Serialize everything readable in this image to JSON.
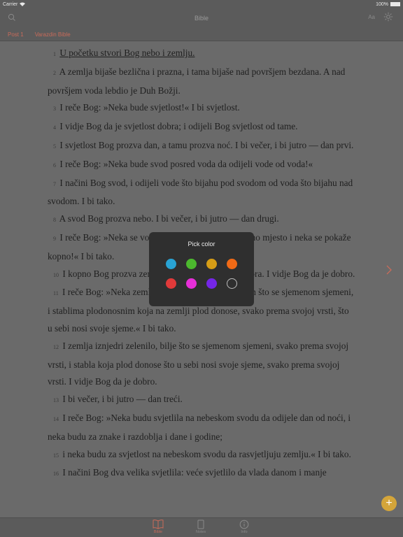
{
  "status_bar": {
    "carrier": "Carrier",
    "battery": "100%"
  },
  "nav": {
    "title": "Bible",
    "font_button": "Aa",
    "search_icon": "search-icon",
    "brightness_icon": "sun-icon"
  },
  "tabs": [
    "Post 1",
    "Varazdin Bible"
  ],
  "verses": [
    {
      "num": "1",
      "text": "U početku stvori Bog nebo i zemlju."
    },
    {
      "num": "2",
      "text": "A zemlja bijaše bezlična i prazna, i tama bijaše nad površjem bezdana. A nad površjem voda lebdio je Duh Božji."
    },
    {
      "num": "3",
      "text": "I reče Bog: »Neka bude svjetlost!« I bi svjetlost."
    },
    {
      "num": "4",
      "text": "I vidje Bog da je svjetlost dobra; i odijeli Bog svjetlost od tame."
    },
    {
      "num": "5",
      "text": "I svjetlost Bog prozva dan, a tamu prozva noć. I bi večer, i bi jutro — dan prvi."
    },
    {
      "num": "6",
      "text": "I reče Bog: »Neka bude svod posred voda da odijeli vode od voda!«"
    },
    {
      "num": "7",
      "text": "I načini Bog svod, i odijeli vode što bijahu pod svodom od voda što bijahu nad svodom. I bi tako."
    },
    {
      "num": "8",
      "text": "A svod Bog prozva nebo. I bi večer, i bi jutro — dan drugi."
    },
    {
      "num": "9",
      "text": "I reče Bog: »Neka se vode pod nebom skupe na jedno mjesto i neka se pokaže kopno!« I bi tako."
    },
    {
      "num": "10",
      "text": "I kopno Bog prozva zemlja, a skup voda prozva mora. I vidje Bog da je dobro."
    },
    {
      "num": "11",
      "text": "I reče Bog: »Neka zemlja proklija zelenilom, biljem što se sjemenom sjemeni, i stablima plodonosnim koja na zemlji plod donose, svako prema svojoj vrsti, što u sebi nosi svoje sjeme.« I bi tako."
    },
    {
      "num": "12",
      "text": "I zemlja iznjedri zelenilo, bilje što se sjemenom sjemeni, svako prema svojoj vrsti, i stabla koja plod donose što u sebi nosi svoje sjeme, svako prema svojoj vrsti. I vidje Bog da je dobro."
    },
    {
      "num": "13",
      "text": "I bi večer, i bi jutro — dan treći."
    },
    {
      "num": "14",
      "text": "I reče Bog: »Neka budu svjetlila na nebeskom svodu da odijele dan od noći, i neka budu za znake i razdoblja i dane i godine;"
    },
    {
      "num": "15",
      "text": "i neka budu za svjetlost na nebeskom svodu da rasvjetljuju zemlju.« I bi tako."
    },
    {
      "num": "16",
      "text": "I načini Bog dva velika svjetlila: veće svjetlilo da vlada danom i manje"
    }
  ],
  "color_picker": {
    "title": "Pick color",
    "colors": [
      "#29a3d4",
      "#4cb92e",
      "#d69d16",
      "#f06a16",
      "#e03a3a",
      "#e62fd8",
      "#7426e6",
      "none"
    ]
  },
  "fab": {
    "label": "+"
  },
  "bottom_tabs": [
    {
      "label": "Bible",
      "icon": "book-icon",
      "active": true
    },
    {
      "label": "Notes",
      "icon": "note-icon",
      "active": false
    },
    {
      "label": "Info",
      "icon": "info-icon",
      "active": false
    }
  ]
}
